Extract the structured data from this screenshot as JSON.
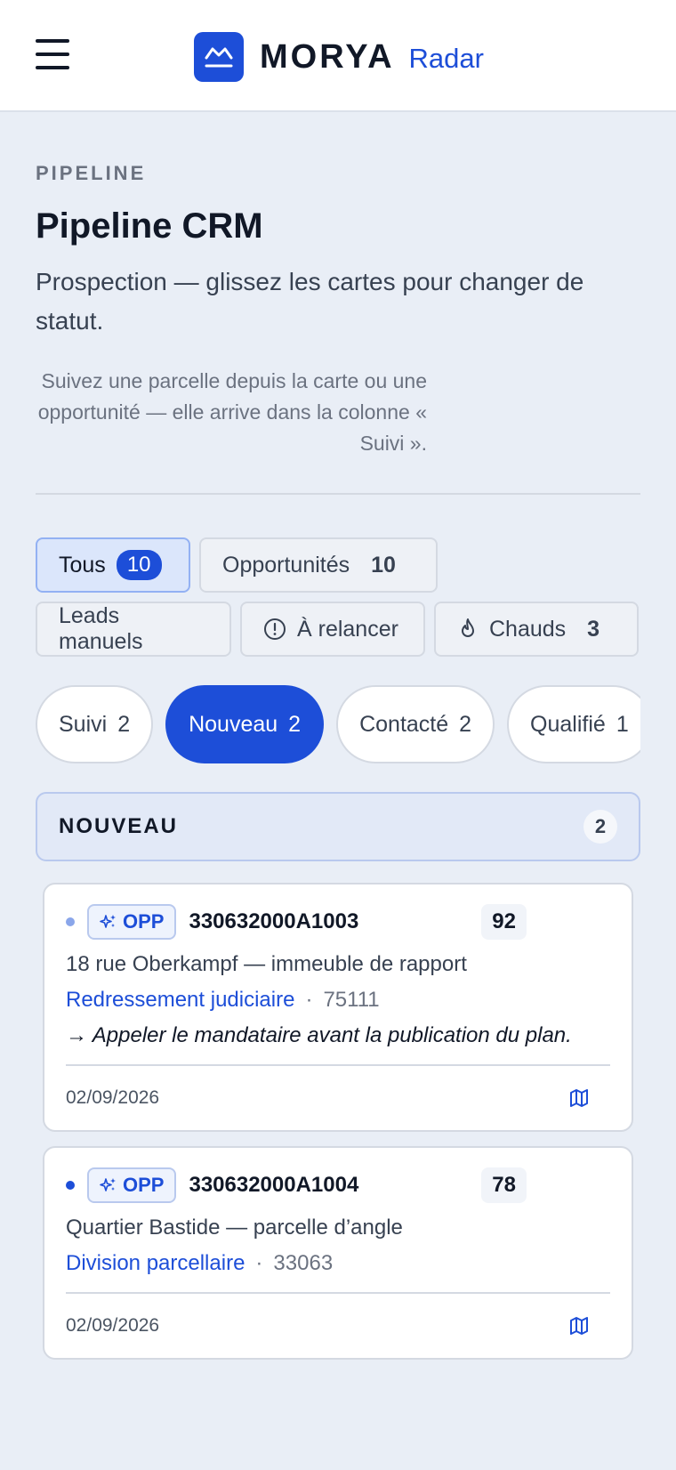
{
  "header": {
    "brand": "MORYA",
    "sub": "Radar"
  },
  "page": {
    "eyebrow": "PIPELINE",
    "title": "Pipeline CRM",
    "subtitle": "Prospection — glissez les cartes pour changer de statut.",
    "hint": "Suivez une parcelle depuis la carte ou une opportunité — elle arrive dans la colonne « Suivi »."
  },
  "filters": [
    {
      "label": "Tous",
      "count": "10",
      "active": true
    },
    {
      "label": "Opportunités",
      "count": "10"
    },
    {
      "label": "Leads manuels"
    },
    {
      "label": "À relancer",
      "icon": "alert-circle-icon"
    },
    {
      "label": "Chauds",
      "count": "3",
      "icon": "flame-icon"
    }
  ],
  "tabs": [
    {
      "label": "Suivi",
      "count": "2"
    },
    {
      "label": "Nouveau",
      "count": "2",
      "active": true
    },
    {
      "label": "Contacté",
      "count": "2"
    },
    {
      "label": "Qualifié",
      "count": "1"
    }
  ],
  "column": {
    "title": "NOUVEAU",
    "count": "2"
  },
  "cards": [
    {
      "badge": "OPP",
      "id": "330632000A1003",
      "score": "92",
      "address": "18 rue Oberkampf — immeuble de rapport",
      "procedure": "Redressement judiciaire",
      "sep": "·",
      "postal": "75111",
      "action": "→ Appeler le mandataire avant la publication du plan.",
      "date": "02/09/2026",
      "dot_color": "#8aa6ea"
    },
    {
      "badge": "OPP",
      "id": "330632000A1004",
      "score": "78",
      "address": "Quartier Bastide — parcelle d’angle",
      "procedure": "Division parcellaire",
      "sep": "·",
      "postal": "33063",
      "date": "02/09/2026",
      "dot_color": "#1d4ed8"
    }
  ],
  "colors": {
    "accent": "#1d4ed8",
    "background": "#e9eef6"
  }
}
